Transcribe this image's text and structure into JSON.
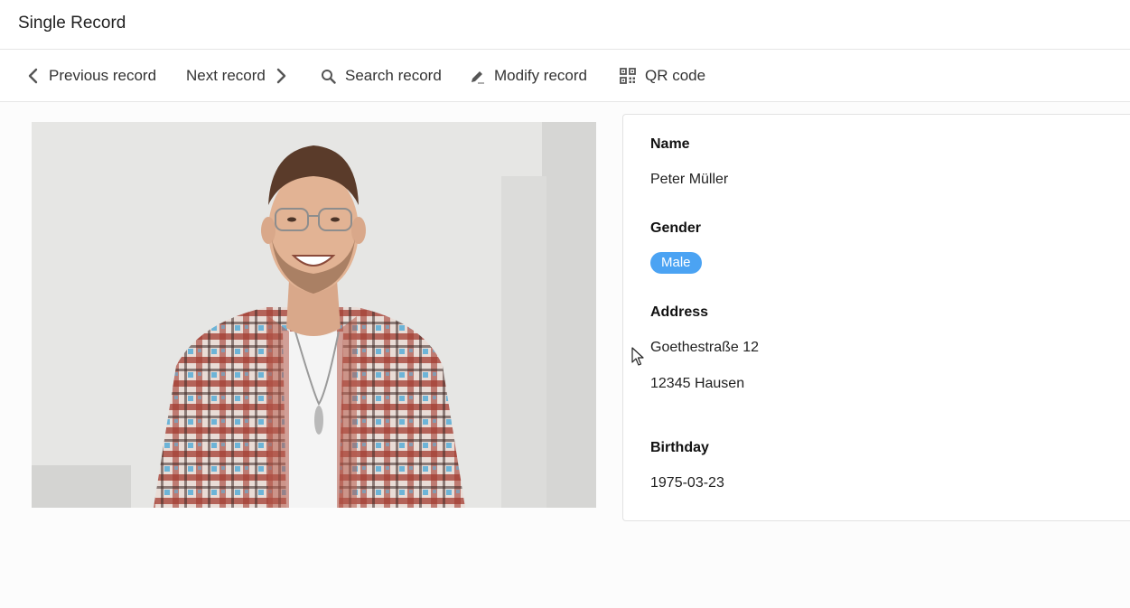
{
  "window": {
    "title": "Single Record"
  },
  "toolbar": {
    "previous_label": "Previous record",
    "next_label": "Next record",
    "search_label": "Search record",
    "modify_label": "Modify record",
    "qr_label": "QR code"
  },
  "record": {
    "fields": {
      "name": {
        "label": "Name",
        "value": "Peter Müller"
      },
      "gender": {
        "label": "Gender",
        "value": "Male"
      },
      "address": {
        "label": "Address",
        "line1": "Goethestraße 12",
        "line2": "12345 Hausen"
      },
      "birthday": {
        "label": "Birthday",
        "value": "1975-03-23"
      }
    }
  },
  "colors": {
    "gender_tag": "#4ba3f3"
  },
  "icons": {
    "previous": "chevron-left-icon",
    "next": "chevron-right-icon",
    "search": "search-icon",
    "modify": "pencil-icon",
    "qr": "qr-code-icon"
  }
}
